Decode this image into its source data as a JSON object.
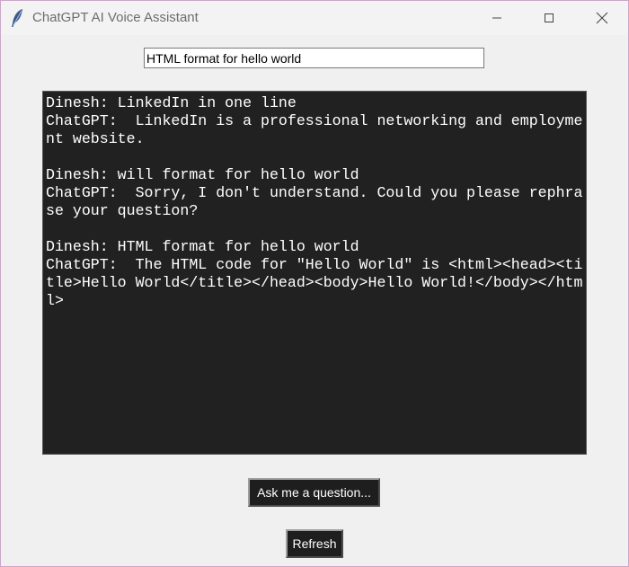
{
  "window": {
    "title": "ChatGPT AI Voice Assistant",
    "icons": {
      "app": "feather-icon",
      "minimize": "minimize-icon",
      "maximize": "maximize-icon",
      "close": "close-icon"
    }
  },
  "query": {
    "value": "HTML format for hello world"
  },
  "chat": {
    "lines": [
      "Dinesh: LinkedIn in one line",
      "ChatGPT:  LinkedIn is a professional networking and employme",
      "nt website.",
      "",
      "Dinesh: will format for hello world",
      "ChatGPT:  Sorry, I don't understand. Could you please rephra",
      "se your question?",
      "",
      "Dinesh: HTML format for hello world",
      "ChatGPT:  The HTML code for \"Hello World\" is <html><head><ti",
      "tle>Hello World</title></head><body>Hello World!</body></htm",
      "l>"
    ]
  },
  "buttons": {
    "ask_label": "Ask me a question...",
    "refresh_label": "Refresh"
  },
  "colors": {
    "chat_background": "#212121",
    "chat_text": "#ffffff",
    "button_background": "#1e1e1e",
    "window_background": "#f0f0f0"
  }
}
